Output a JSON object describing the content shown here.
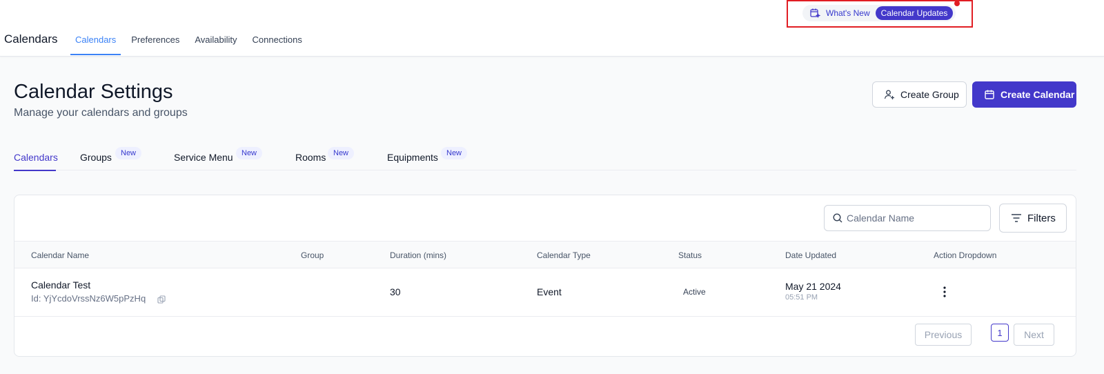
{
  "header": {
    "app_title": "Calendars",
    "nav": [
      {
        "label": "Calendars",
        "active": true
      },
      {
        "label": "Preferences"
      },
      {
        "label": "Availability"
      },
      {
        "label": "Connections"
      }
    ],
    "whats_new": {
      "label": "What's New",
      "pill": "Calendar Updates",
      "icon": "calendar-sparkle-icon"
    }
  },
  "page": {
    "title": "Calendar Settings",
    "subtitle": "Manage your calendars and groups",
    "create_group": {
      "label": "Create Group",
      "icon": "user-plus-icon"
    },
    "create_calendar": {
      "label": "Create Calendar",
      "icon": "calendar-icon"
    }
  },
  "subtabs": [
    {
      "label": "Calendars",
      "active": true
    },
    {
      "label": "Groups",
      "badge": "New"
    },
    {
      "label": "Service Menu",
      "badge": "New"
    },
    {
      "label": "Rooms",
      "badge": "New"
    },
    {
      "label": "Equipments",
      "badge": "New"
    }
  ],
  "table": {
    "search_placeholder": "Calendar Name",
    "filters_label": "Filters",
    "columns": [
      "Calendar Name",
      "Group",
      "Duration (mins)",
      "Calendar Type",
      "Status",
      "Date Updated",
      "Action Dropdown"
    ],
    "rows": [
      {
        "name": "Calendar Test",
        "id": "Id: YjYcdoVrssNz6W5pPzHq",
        "group": "",
        "duration": "30",
        "type": "Event",
        "status": "Active",
        "date": "May 21 2024",
        "time": "05:51 PM"
      }
    ],
    "pagination": {
      "previous": "Previous",
      "page": "1",
      "next": "Next"
    }
  },
  "colors": {
    "primary": "#4338ca",
    "nav_active": "#3b82f6",
    "highlight_box": "#e11d23"
  }
}
